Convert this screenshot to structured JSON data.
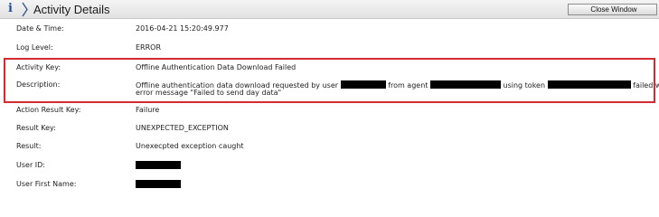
{
  "window": {
    "title": "Activity Details",
    "close_label": "Close Window"
  },
  "rows": {
    "datetime": {
      "label": "Date & Time:",
      "value": "2016-04-21 15:20:49.977"
    },
    "loglevel": {
      "label": "Log Level:",
      "value": "ERROR"
    },
    "activitykey": {
      "label": "Activity Key:",
      "value": "Offline Authentication Data Download Failed"
    },
    "description": {
      "label": "Description:",
      "part1": "Offline authentication data download requested by user",
      "part2": "from agent",
      "part3": "using token",
      "part4": "failed with",
      "line2": "error message \"Failed to send day data\""
    },
    "actionresultkey": {
      "label": "Action Result Key:",
      "value": "Failure"
    },
    "resultkey": {
      "label": "Result Key:",
      "value": "UNEXPECTED_EXCEPTION"
    },
    "result": {
      "label": "Result:",
      "value": "Unexecpted exception caught"
    },
    "userid": {
      "label": "User ID:"
    },
    "userfirstname": {
      "label": "User First Name:"
    }
  },
  "colors": {
    "highlight_border": "#d42a32",
    "icon_blue": "#1f4e9c"
  },
  "icons": {
    "title_icon": "info-icon"
  }
}
